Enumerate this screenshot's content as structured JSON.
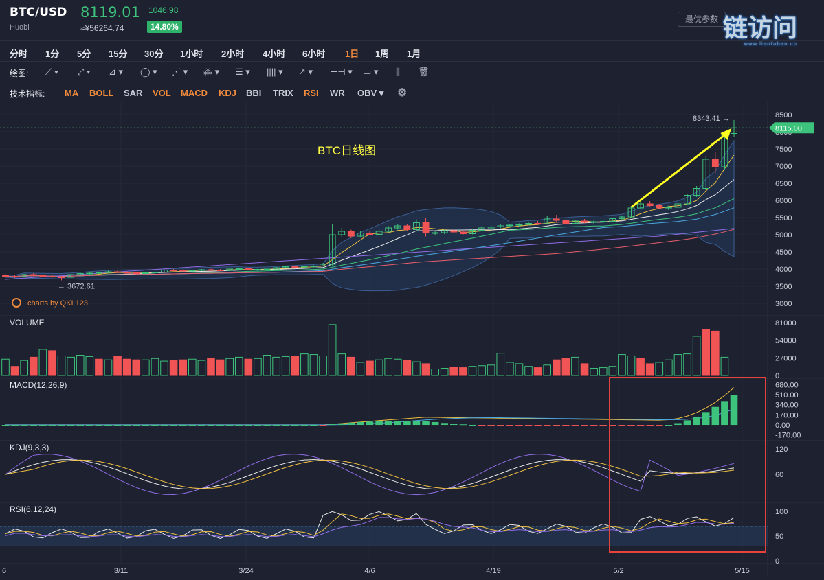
{
  "header": {
    "pair": "BTC/USD",
    "exchange": "Huobi",
    "last_price": "8119.01",
    "cny_price": "≈¥56264.74",
    "change": "1046.98",
    "change_pct": "14.80%",
    "options_button": "最优参数",
    "watermark": "链访问",
    "watermark_sub": "www.lianfaban.cn"
  },
  "periods": [
    "分时",
    "1分",
    "5分",
    "15分",
    "30分",
    "1小时",
    "2小时",
    "4小时",
    "6小时",
    "1日",
    "1周",
    "1月"
  ],
  "active_period": "1日",
  "draw_label": "绘图:",
  "indicators_label": "技术指标:",
  "indicators": [
    {
      "label": "MA",
      "active": true
    },
    {
      "label": "BOLL",
      "active": true
    },
    {
      "label": "SAR",
      "active": false
    },
    {
      "label": "VOL",
      "active": true
    },
    {
      "label": "MACD",
      "active": true
    },
    {
      "label": "KDJ",
      "active": true
    },
    {
      "label": "BBI",
      "active": false
    },
    {
      "label": "TRIX",
      "active": false
    },
    {
      "label": "RSI",
      "active": true
    },
    {
      "label": "WR",
      "active": false
    },
    {
      "label": "OBV",
      "active": false
    }
  ],
  "colors": {
    "up": "#3dc37c",
    "down": "#f05454",
    "accent": "#f08a3c",
    "background": "#1e2130",
    "annotation_text": "#ffff44",
    "highlight_box": "#e8423c"
  },
  "chart_data": {
    "type": "candlestick",
    "annotation": "BTC日线图",
    "credit": "charts by QKL123",
    "price_axis": {
      "ticks": [
        "8500",
        "8000",
        "7500",
        "7000",
        "6500",
        "6000",
        "5500",
        "5000",
        "4500",
        "4000",
        "3500",
        "3000"
      ],
      "ylim": [
        2800,
        8700
      ]
    },
    "current_price_tag": "8115.00",
    "high_label": "8343.41",
    "low_label": "3672.61",
    "x_ticks": [
      "6",
      "3/11",
      "3/24",
      "4/6",
      "4/19",
      "5/2",
      "5/15"
    ],
    "candles": [
      [
        3830,
        3850,
        3760,
        3790
      ],
      [
        3790,
        3840,
        3740,
        3780
      ],
      [
        3780,
        3860,
        3770,
        3840
      ],
      [
        3840,
        3880,
        3790,
        3810
      ],
      [
        3810,
        3850,
        3770,
        3790
      ],
      [
        3790,
        3830,
        3750,
        3770
      ],
      [
        3770,
        3800,
        3672,
        3760
      ],
      [
        3760,
        3860,
        3750,
        3840
      ],
      [
        3840,
        3900,
        3800,
        3870
      ],
      [
        3870,
        3910,
        3840,
        3880
      ],
      [
        3880,
        3920,
        3860,
        3900
      ],
      [
        3900,
        3950,
        3880,
        3920
      ],
      [
        3920,
        3960,
        3890,
        3900
      ],
      [
        3900,
        3930,
        3870,
        3890
      ],
      [
        3890,
        3910,
        3850,
        3880
      ],
      [
        3880,
        3920,
        3860,
        3890
      ],
      [
        3890,
        3940,
        3870,
        3910
      ],
      [
        3910,
        3990,
        3900,
        3970
      ],
      [
        3970,
        4000,
        3940,
        3960
      ],
      [
        3960,
        3990,
        3930,
        3950
      ],
      [
        3950,
        3980,
        3920,
        3960
      ],
      [
        3960,
        4000,
        3940,
        3980
      ],
      [
        3980,
        4010,
        3950,
        3970
      ],
      [
        3970,
        4000,
        3940,
        3960
      ],
      [
        3960,
        4010,
        3950,
        4000
      ],
      [
        4000,
        4040,
        3980,
        4010
      ],
      [
        4010,
        4040,
        3970,
        3980
      ],
      [
        3980,
        4010,
        3940,
        3990
      ],
      [
        3990,
        4020,
        3960,
        4000
      ],
      [
        4000,
        4060,
        3990,
        4040
      ],
      [
        4040,
        4090,
        4020,
        4070
      ],
      [
        4070,
        4100,
        4040,
        4060
      ],
      [
        4060,
        4090,
        4030,
        4080
      ],
      [
        4080,
        4110,
        4050,
        4090
      ],
      [
        4090,
        4180,
        4080,
        4140
      ],
      [
        4140,
        5300,
        4100,
        5000
      ],
      [
        5000,
        5200,
        4920,
        5100
      ],
      [
        5100,
        5150,
        4900,
        4960
      ],
      [
        4960,
        5100,
        4930,
        5050
      ],
      [
        5050,
        5120,
        4980,
        5010
      ],
      [
        5010,
        5150,
        4990,
        5100
      ],
      [
        5100,
        5250,
        5050,
        5200
      ],
      [
        5200,
        5300,
        5150,
        5260
      ],
      [
        5260,
        5320,
        5100,
        5150
      ],
      [
        5150,
        5450,
        5120,
        5350
      ],
      [
        5350,
        5500,
        4950,
        5050
      ],
      [
        5050,
        5120,
        4980,
        5060
      ],
      [
        5060,
        5150,
        5020,
        5120
      ],
      [
        5120,
        5180,
        5050,
        5080
      ],
      [
        5080,
        5140,
        5000,
        5030
      ],
      [
        5030,
        5160,
        5010,
        5130
      ],
      [
        5130,
        5250,
        5100,
        5200
      ],
      [
        5200,
        5280,
        5150,
        5230
      ],
      [
        5230,
        5300,
        5190,
        5260
      ],
      [
        5260,
        5320,
        5220,
        5280
      ],
      [
        5280,
        5330,
        5230,
        5300
      ],
      [
        5300,
        5380,
        5270,
        5330
      ],
      [
        5330,
        5400,
        5280,
        5320
      ],
      [
        5320,
        5560,
        5300,
        5460
      ],
      [
        5460,
        5580,
        5380,
        5420
      ],
      [
        5420,
        5500,
        5300,
        5330
      ],
      [
        5330,
        5430,
        5300,
        5400
      ],
      [
        5400,
        5460,
        5340,
        5360
      ],
      [
        5360,
        5420,
        5320,
        5380
      ],
      [
        5380,
        5440,
        5340,
        5390
      ],
      [
        5390,
        5500,
        5360,
        5470
      ],
      [
        5470,
        5560,
        5420,
        5520
      ],
      [
        5520,
        5820,
        5500,
        5780
      ],
      [
        5780,
        5960,
        5740,
        5900
      ],
      [
        5900,
        5980,
        5800,
        5850
      ],
      [
        5850,
        5900,
        5740,
        5780
      ],
      [
        5780,
        5850,
        5720,
        5800
      ],
      [
        5800,
        5970,
        5780,
        5900
      ],
      [
        5900,
        6200,
        5860,
        6150
      ],
      [
        6150,
        6420,
        6100,
        6350
      ],
      [
        6350,
        7300,
        6300,
        7200
      ],
      [
        7200,
        7400,
        6800,
        6980
      ],
      [
        6980,
        8000,
        6900,
        7950
      ],
      [
        7950,
        8343,
        7850,
        8115
      ]
    ],
    "ma_series": [
      {
        "color": "#f0c040",
        "period": 5
      },
      {
        "color": "#e9e9e9",
        "period": 10
      },
      {
        "color": "#3dc37c",
        "period": 20
      },
      {
        "color": "#4aa7e0",
        "period": 30
      },
      {
        "color": "#e85f6c",
        "period": 60
      },
      {
        "color": "#8f6de6",
        "period": 120
      }
    ],
    "volume": {
      "label": "VOLUME",
      "ticks": [
        "81000",
        "54000",
        "27000",
        "0"
      ],
      "values": [
        25000,
        14000,
        23000,
        28000,
        40000,
        38000,
        30000,
        28000,
        31000,
        29000,
        25000,
        24000,
        29000,
        25000,
        24000,
        24000,
        26000,
        22000,
        23000,
        24000,
        25000,
        23000,
        26000,
        24000,
        26000,
        28000,
        25000,
        26000,
        31000,
        28000,
        29000,
        30000,
        33000,
        32000,
        30000,
        78000,
        33000,
        28000,
        20000,
        22000,
        24000,
        26000,
        25000,
        23000,
        21000,
        18000,
        10000,
        11000,
        13000,
        12000,
        14000,
        15000,
        16000,
        34000,
        20000,
        18000,
        14000,
        12000,
        16000,
        24000,
        26000,
        28000,
        18000,
        11000,
        12000,
        14000,
        32000,
        30000,
        26000,
        18000,
        20000,
        24000,
        32000,
        33000,
        60000,
        70000,
        68000,
        28000
      ],
      "up_flags": [
        1,
        0,
        1,
        0,
        1,
        0,
        1,
        1,
        1,
        1,
        0,
        1,
        0,
        0,
        0,
        1,
        1,
        1,
        0,
        0,
        1,
        1,
        0,
        0,
        1,
        1,
        0,
        1,
        1,
        1,
        1,
        0,
        1,
        1,
        1,
        1,
        1,
        0,
        1,
        0,
        1,
        1,
        1,
        0,
        1,
        0,
        1,
        1,
        0,
        0,
        1,
        1,
        1,
        1,
        1,
        1,
        1,
        0,
        1,
        0,
        0,
        1,
        0,
        1,
        1,
        1,
        1,
        1,
        0,
        0,
        1,
        1,
        1,
        1,
        1,
        0,
        0,
        1
      ]
    },
    "macd": {
      "label": "MACD(12,26,9)",
      "ticks": [
        "680.00",
        "510.00",
        "340.00",
        "170.00",
        "0.00",
        "-170.00"
      ],
      "ylim": [
        -220,
        720
      ]
    },
    "kdj": {
      "label": "KDJ(9,3,3)",
      "ticks": [
        "120",
        "60"
      ],
      "ylim": [
        0,
        130
      ]
    },
    "rsi": {
      "label": "RSI(6,12,24)",
      "ticks": [
        "100",
        "50",
        "0"
      ],
      "ylim": [
        0,
        110
      ],
      "band": [
        30,
        70
      ]
    }
  }
}
